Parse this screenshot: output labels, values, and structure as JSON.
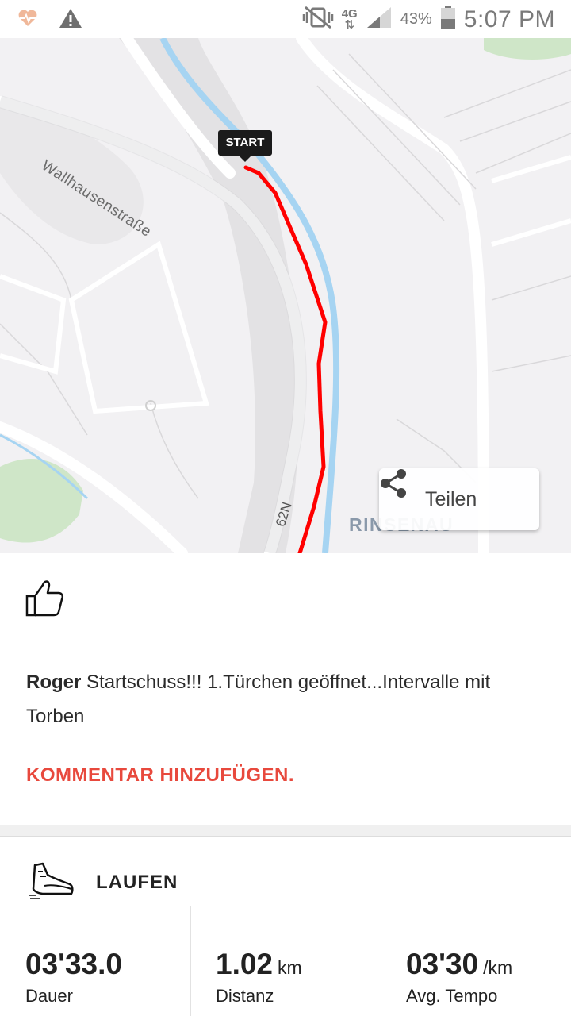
{
  "status_bar": {
    "battery": "43%",
    "time": "5:07 PM",
    "network": "4G",
    "icons": [
      "heart-monitor-icon",
      "warning-icon",
      "vibrate-off-icon",
      "signal-icon",
      "battery-icon"
    ]
  },
  "map": {
    "start_label": "START",
    "street_label": "Wallhausenstraße",
    "road_label": "62N",
    "area_label": "RINSENAU",
    "share_label": "Teilen",
    "route_color": "#ff0000"
  },
  "comment": {
    "user": "Roger",
    "text": " Startschuss!!! 1.Türchen geöffnet...Intervalle mit Torben",
    "add_comment": "KOMMENTAR HINZUFÜGEN."
  },
  "activity": {
    "type": "LAUFEN",
    "stats": [
      {
        "value": "03'33.0",
        "unit": "",
        "label": "Dauer"
      },
      {
        "value": "1.02",
        "unit": "km",
        "label": "Distanz"
      },
      {
        "value": "03'30",
        "unit": "/km",
        "label": "Avg. Tempo"
      }
    ]
  },
  "colors": {
    "accent": "#e8493d",
    "route": "#ff0000",
    "river": "#a6d4f2"
  }
}
